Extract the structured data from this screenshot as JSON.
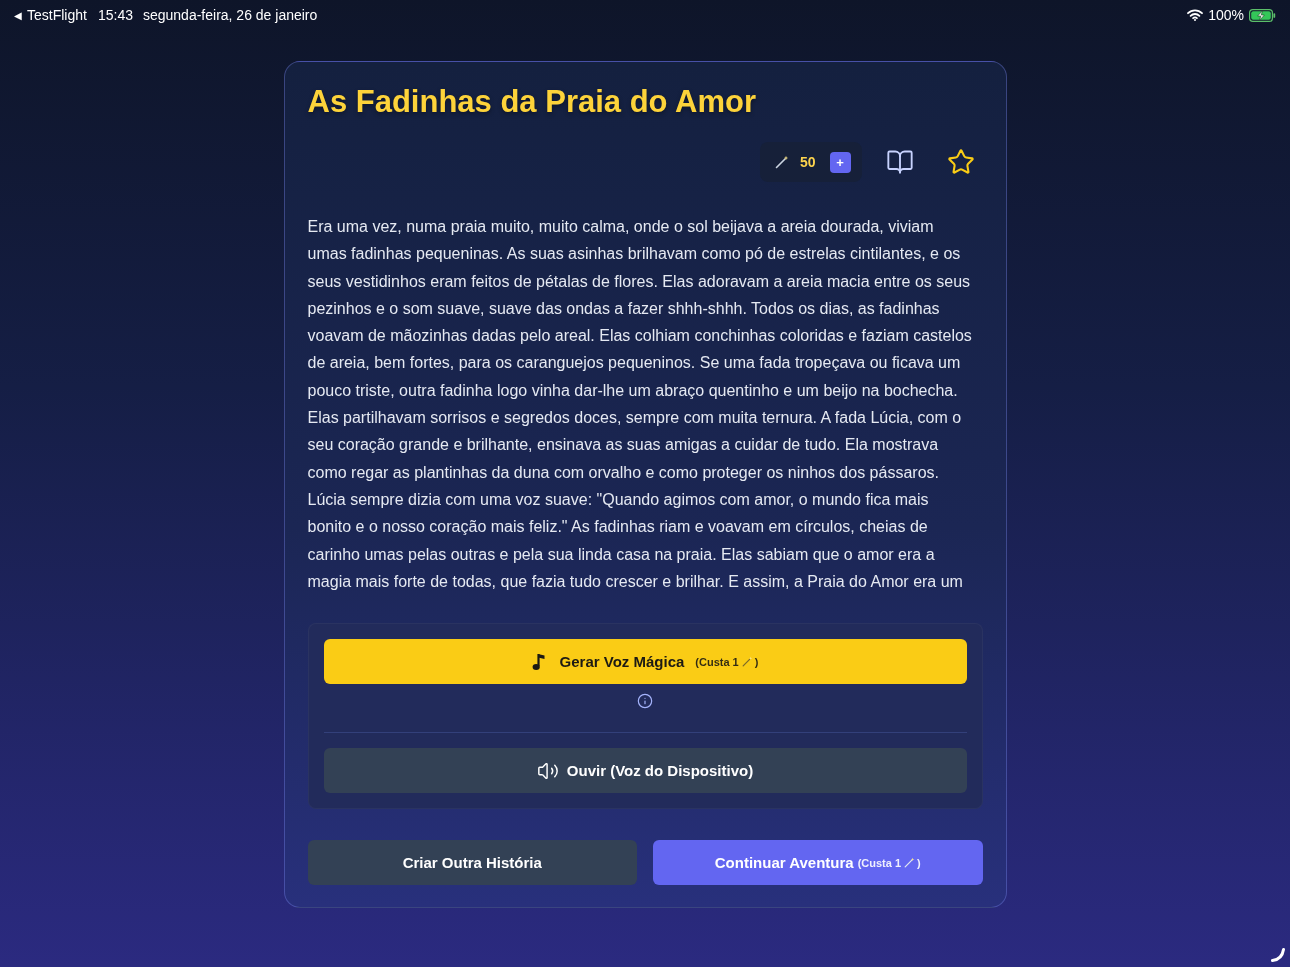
{
  "status_bar": {
    "back_glyph": "◀",
    "back_app": "TestFlight",
    "time": "15:43",
    "date": "segunda-feira, 26 de janeiro",
    "battery": "100%"
  },
  "story": {
    "title": "As Fadinhas da Praia do Amor",
    "credits": "50",
    "add_credits": "+",
    "favorited": false,
    "text": "Era uma vez, numa praia muito, muito calma, onde o sol beijava a areia dourada, viviam umas fadinhas pequeninas. As suas asinhas brilhavam como pó de estrelas cintilantes, e os seus vestidinhos eram feitos de pétalas de flores. Elas adoravam a areia macia entre os seus pezinhos e o som suave, suave das ondas a fazer shhh-shhh. Todos os dias, as fadinhas voavam de mãozinhas dadas pelo areal. Elas colhiam conchinhas coloridas e faziam castelos de areia, bem fortes, para os caranguejos pequeninos. Se uma fada tropeçava ou ficava um pouco triste, outra fadinha logo vinha dar-lhe um abraço quentinho e um beijo na bochecha. Elas partilhavam sorrisos e segredos doces, sempre com muita ternura. A fada Lúcia, com o seu coração grande e brilhante, ensinava as suas amigas a cuidar de tudo. Ela mostrava como regar as plantinhas da duna com orvalho e como proteger os ninhos dos pássaros. Lúcia sempre dizia com uma voz suave: \"Quando agimos com amor, o mundo fica mais bonito e o nosso coração mais feliz.\" As fadinhas riam e voavam em círculos, cheias de carinho umas pelas outras e pela sua linda casa na praia. Elas sabiam que o amor era a magia mais forte de todas, que fazia tudo crescer e brilhar. E assim, a Praia do Amor era um"
  },
  "voice_panel": {
    "buttons": [
      {
        "kind": "magic",
        "label": "Gerar Voz Mágica",
        "cost": "(Custa 1",
        "cost_end": ")"
      },
      {
        "kind": "device",
        "label": "Ouvir (Voz do Dispositivo)"
      }
    ]
  },
  "actions": [
    {
      "kind": "secondary",
      "label": "Criar Outra História"
    },
    {
      "kind": "primary",
      "label": "Continuar Aventura",
      "cost": "(Custa 1",
      "cost_end": ")"
    }
  ]
}
